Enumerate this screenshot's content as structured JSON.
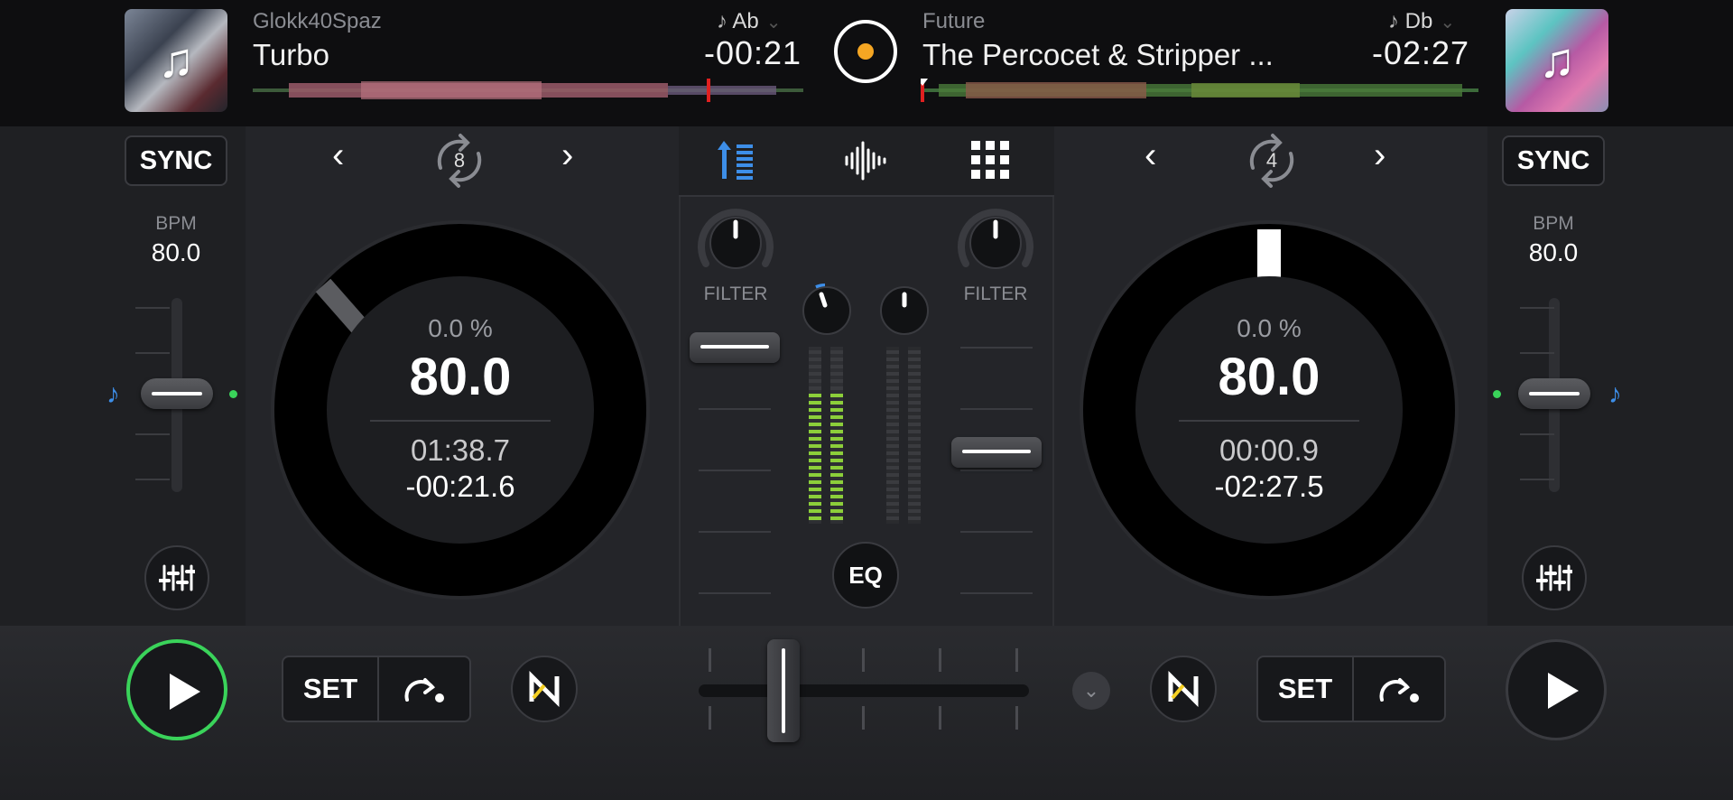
{
  "left_deck": {
    "artist": "Glokk40Spaz",
    "title": "Turbo",
    "key_label": "Ab",
    "remaining": "-00:21",
    "sync_label": "SYNC",
    "bpm_label": "BPM",
    "bpm_value": "80.0",
    "pitch_percent": "0.0 %",
    "tempo": "80.0",
    "elapsed": "01:38.7",
    "time_left": "-00:21.6",
    "loop_size": "8"
  },
  "right_deck": {
    "artist": "Future",
    "title": "The Percocet & Stripper ...",
    "key_label": "Db",
    "remaining": "-02:27",
    "sync_label": "SYNC",
    "bpm_label": "BPM",
    "bpm_value": "80.0",
    "pitch_percent": "0.0 %",
    "tempo": "80.0",
    "elapsed": "00:00.9",
    "time_left": "-02:27.5",
    "loop_size": "4"
  },
  "mixer": {
    "filter_label_left": "FILTER",
    "filter_label_right": "FILTER",
    "eq_label": "EQ"
  },
  "transport": {
    "set_label_left": "SET",
    "set_label_right": "SET",
    "n_label": "N"
  },
  "colors": {
    "accent_blue": "#3d8ee8",
    "play_active_green": "#3ad35a",
    "center_dot_orange": "#f5a623",
    "meter_green": "#8ccf3a"
  },
  "icons": {
    "album_art": "music-note-icon",
    "loop": "loop-icon",
    "nav_prev": "chevron-left-icon",
    "nav_next": "chevron-right-icon",
    "mixer_tab": "mixer-levels-icon",
    "waveform_tab": "waveform-icon",
    "pads_tab": "grid-icon",
    "eq_settings": "sliders-icon",
    "play": "play-icon",
    "jump": "jump-arrow-icon",
    "chevron_down": "chevron-down-icon"
  }
}
